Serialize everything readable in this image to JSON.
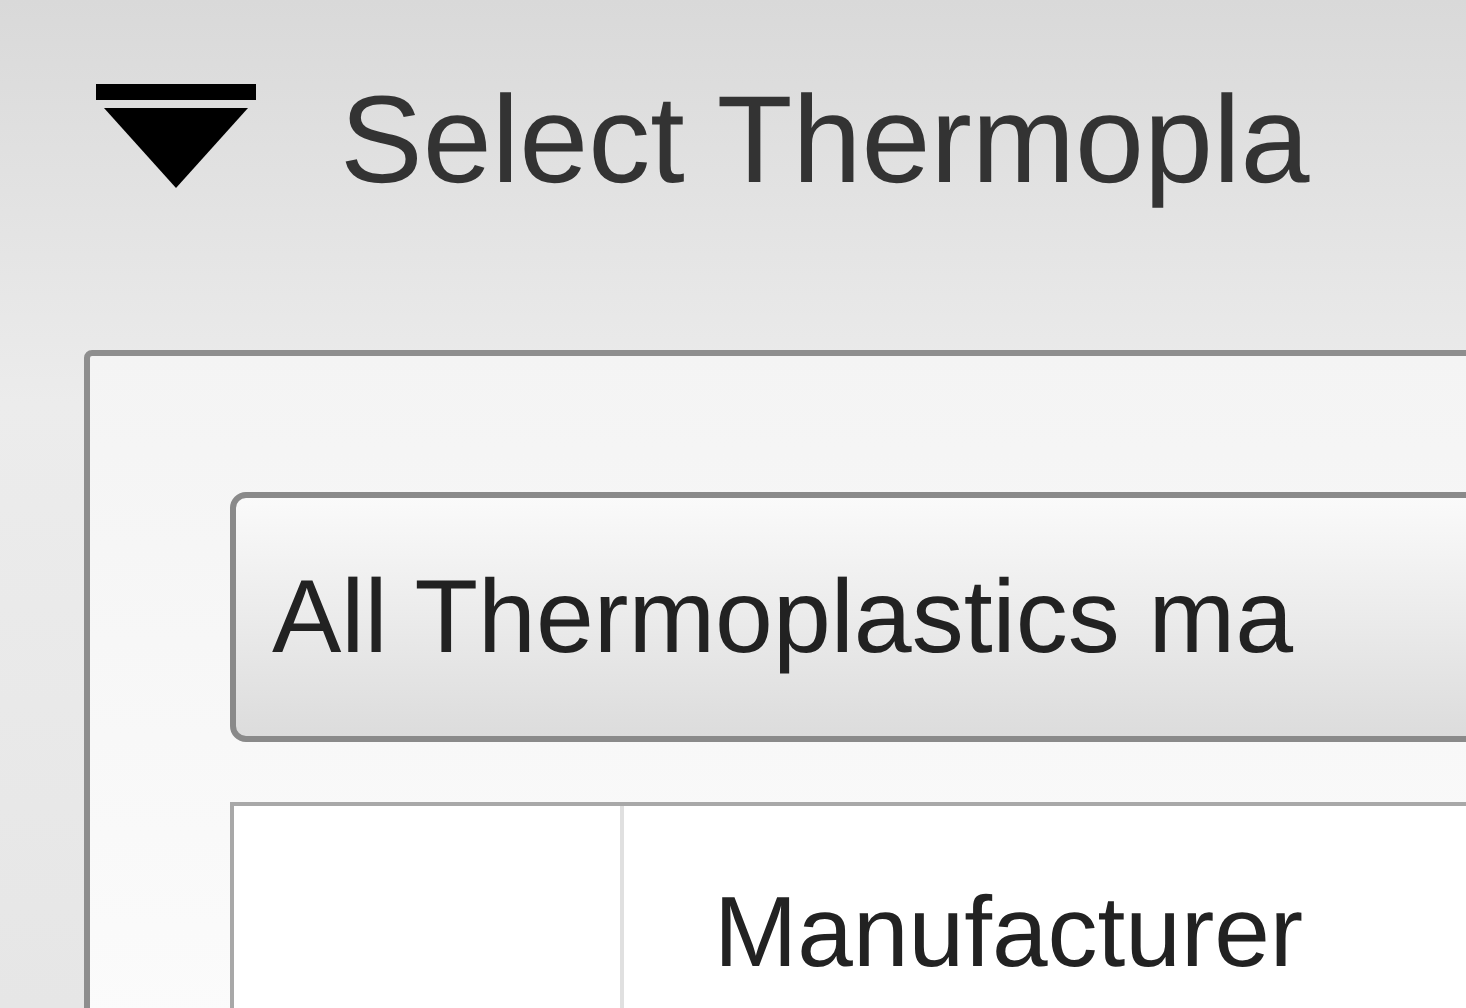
{
  "section": {
    "title": "Select Thermopla",
    "expanded": true
  },
  "filter": {
    "value": "All Thermoplastics ma"
  },
  "table": {
    "columns": [
      "Manufacturer"
    ]
  }
}
